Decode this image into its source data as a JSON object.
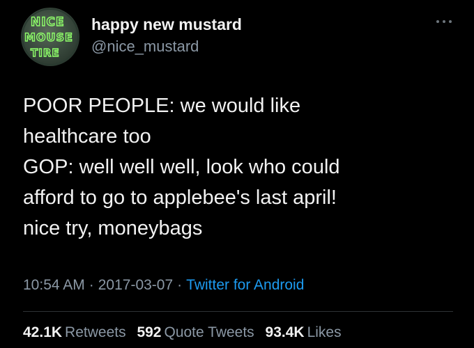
{
  "author": {
    "display_name": "happy new mustard",
    "handle": "@nice_mustard",
    "avatar_text": [
      "NICE",
      "MOUSE",
      "TIRE"
    ]
  },
  "tweet": {
    "lines": [
      "POOR PEOPLE: we would like",
      "healthcare too",
      "GOP: well well well, look who could",
      "afford to go to applebee's last april!",
      "nice try, moneybags"
    ]
  },
  "meta": {
    "time": "10:54 AM",
    "separator": "·",
    "date": "2017-03-07",
    "source": "Twitter for Android"
  },
  "stats": {
    "retweets_count": "42.1K",
    "retweets_label": "Retweets",
    "quotes_count": "592",
    "quotes_label": "Quote Tweets",
    "likes_count": "93.4K",
    "likes_label": "Likes"
  },
  "icons": {
    "more": "more-options-icon"
  },
  "colors": {
    "background": "#000000",
    "text_primary": "#e7e9ea",
    "text_secondary": "#8b98a5",
    "link": "#1d9bf0",
    "avatar_text": "#8fff6a"
  }
}
